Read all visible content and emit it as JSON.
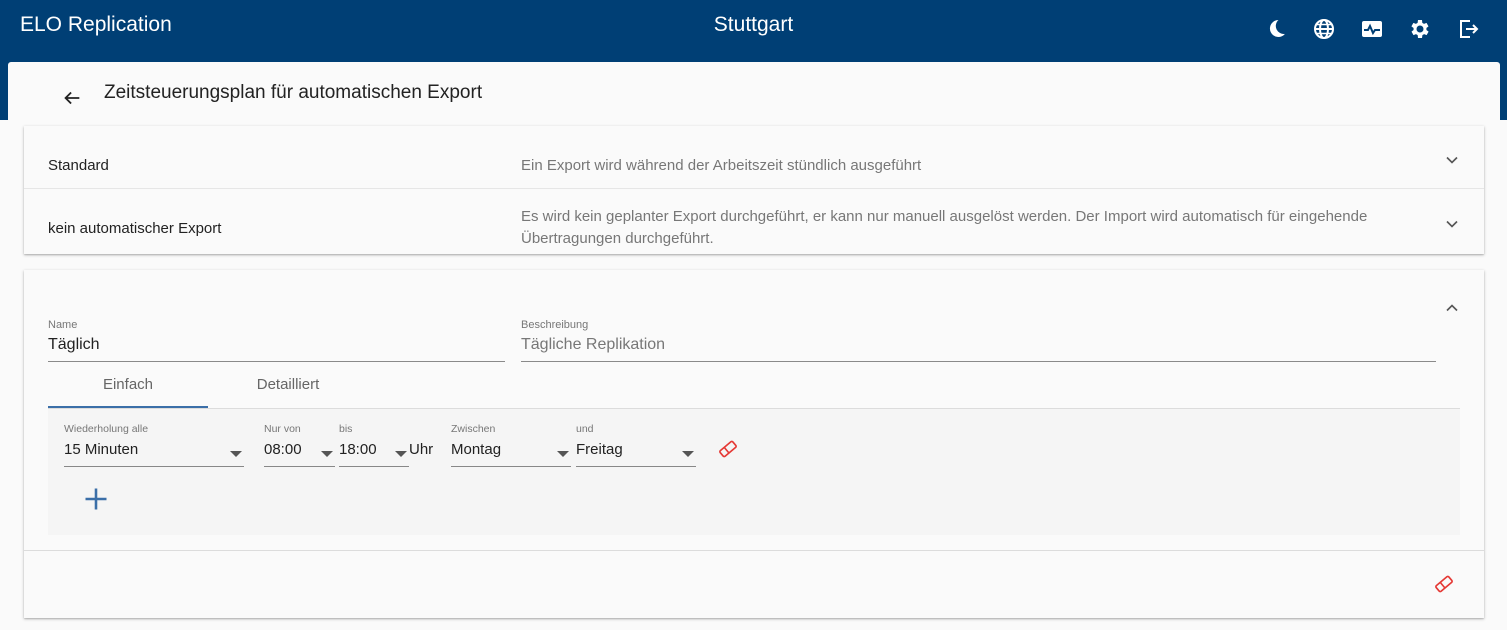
{
  "header": {
    "app_title": "ELO Replication",
    "location": "Stuttgart",
    "icons": [
      "moon-icon",
      "globe-icon",
      "monitor-icon",
      "gear-icon",
      "logout-icon"
    ],
    "bg_color": "#003f75"
  },
  "page": {
    "title": "Zeitsteuerungsplan für automatischen Export"
  },
  "schedules": [
    {
      "name": "Standard",
      "description": "Ein Export wird während der Arbeitszeit stündlich ausgeführt"
    },
    {
      "name": "kein automatischer Export",
      "description": "Es wird kein geplanter Export durchgeführt, er kann nur manuell ausgelöst werden. Der Import wird automatisch für eingehende Übertragungen durchgeführt."
    }
  ],
  "editor": {
    "name_label": "Name",
    "name_value": "Täglich",
    "desc_label": "Beschreibung",
    "desc_value": "Tägliche Replikation",
    "tabs": [
      "Einfach",
      "Detailliert"
    ],
    "active_tab": "Einfach",
    "rule": {
      "repeat_label": "Wiederholung alle",
      "repeat_value": "15 Minuten",
      "from_label": "Nur von",
      "from_value": "08:00",
      "to_label": "bis",
      "to_value": "18:00",
      "unit": "Uhr",
      "between_label": "Zwischen",
      "between_value": "Montag",
      "and_label": "und",
      "and_value": "Freitag"
    },
    "accent_color": "#3b6fa8",
    "delete_color": "#e53935"
  }
}
